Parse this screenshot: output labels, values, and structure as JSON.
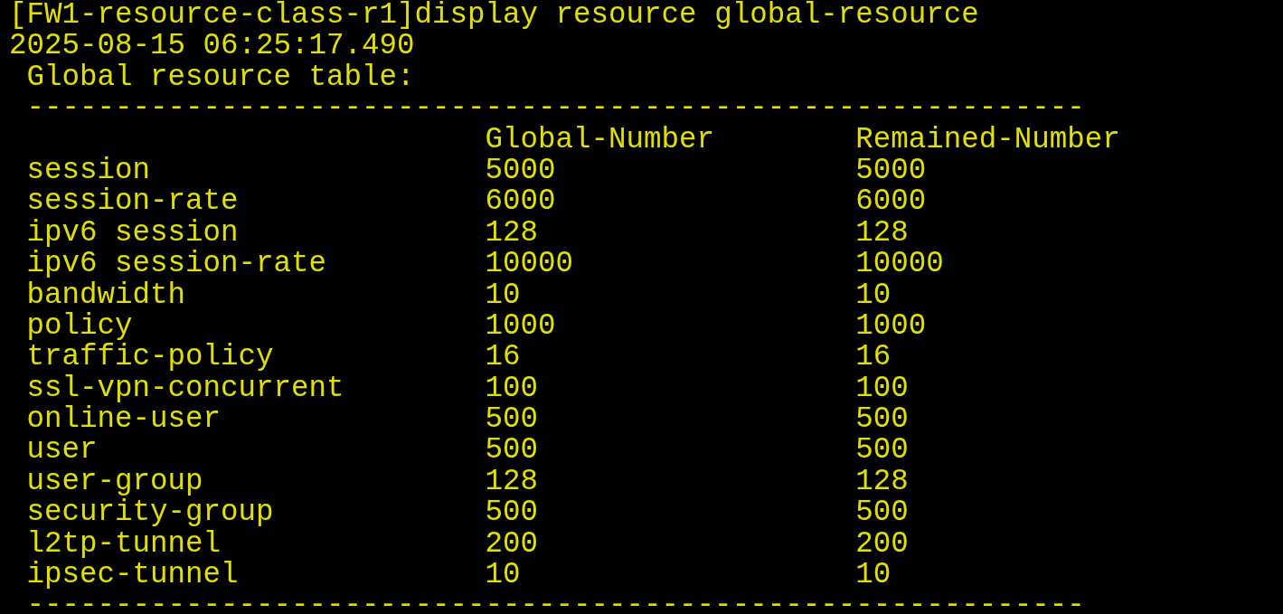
{
  "terminal": {
    "command_line": "[FW1-resource-class-r1]display resource global-resource",
    "timestamp": "2025-08-15 06:25:17.490",
    "table_title": "Global resource table:",
    "separator_top": "------------------------------------------------------------",
    "columns": [
      "Global-Number",
      "Remained-Number"
    ],
    "rows": [
      {
        "name": "session",
        "global": "5000",
        "remained": "5000"
      },
      {
        "name": "session-rate",
        "global": "6000",
        "remained": "6000"
      },
      {
        "name": "ipv6 session",
        "global": "128",
        "remained": "128"
      },
      {
        "name": "ipv6 session-rate",
        "global": "10000",
        "remained": "10000"
      },
      {
        "name": "bandwidth",
        "global": "10",
        "remained": "10"
      },
      {
        "name": "policy",
        "global": "1000",
        "remained": "1000"
      },
      {
        "name": "traffic-policy",
        "global": "16",
        "remained": "16"
      },
      {
        "name": "ssl-vpn-concurrent",
        "global": "100",
        "remained": "100"
      },
      {
        "name": "online-user",
        "global": "500",
        "remained": "500"
      },
      {
        "name": "user",
        "global": "500",
        "remained": "500"
      },
      {
        "name": "user-group",
        "global": "128",
        "remained": "128"
      },
      {
        "name": "security-group",
        "global": "500",
        "remained": "500"
      },
      {
        "name": "l2tp-tunnel",
        "global": "200",
        "remained": "200"
      },
      {
        "name": "ipsec-tunnel",
        "global": "10",
        "remained": "10"
      }
    ],
    "separator_bottom": "------------------------------------------------------------"
  }
}
